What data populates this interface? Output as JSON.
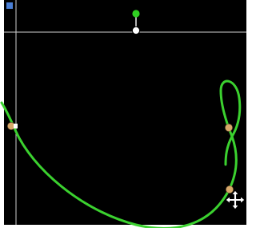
{
  "canvas": {
    "background_color": "#000000",
    "frame_color": "#ffffff",
    "guide_color": "#cfcfcf",
    "path_color": "#3bd12f",
    "anchor_color": "#d8a86a",
    "rotation_handle_color": "#2fd021",
    "selected_point_color": "#ffffff",
    "corner_marker_color": "#4a7fd6"
  },
  "icons": {
    "cursor": "move-cursor-icon",
    "rotation": "rotation-handle-icon",
    "corner": "corner-marker-icon"
  }
}
